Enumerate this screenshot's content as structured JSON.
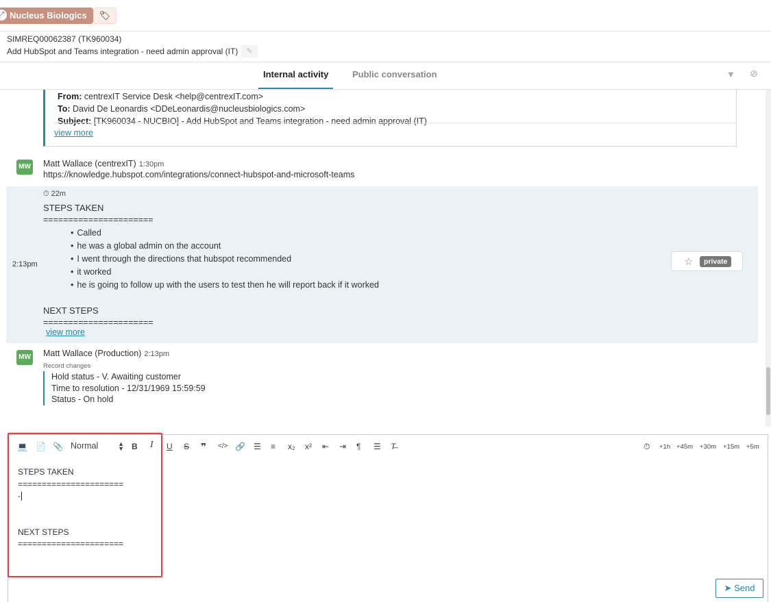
{
  "header": {
    "company": "Nucleus Biologics",
    "ext_icon": "external-link-icon",
    "tag_icon": "tags-icon"
  },
  "ticket": {
    "id": "SIMREQ00062387 (TK960034)",
    "title": "Add HubSpot and Teams integration - need admin approval (IT)"
  },
  "tabs": [
    {
      "label": "Internal activity",
      "active": true
    },
    {
      "label": "Public conversation",
      "active": false
    }
  ],
  "email_preview": {
    "from_label": "From:",
    "from": "centrexIT Service Desk <help@centrexIT.com>",
    "to_label": "To:",
    "to": "David De Leonardis <DDeLeonardis@nucleusbiologics.com>",
    "subject_label": "Subject:",
    "subject": "[TK960034 - NUCBIO] - Add HubSpot and Teams integration - need admin approval (IT)",
    "view_more": "view more"
  },
  "entries": [
    {
      "avatar": "MW",
      "author": "Matt Wallace (centrexIT)",
      "time": "1:30pm",
      "text": "https://knowledge.hubspot.com/integrations/connect-hubspot-and-microsoft-teams"
    }
  ],
  "note": {
    "time": "2:13pm",
    "duration": "22m",
    "heading1": "STEPS TAKEN",
    "sep1": "======================",
    "bullets": [
      "Called",
      "he was a global admin on the account",
      "I went through the directions that hubspot recommended",
      "it worked",
      "he is going to follow up with the users to test then he will report back if it worked"
    ],
    "heading2": "NEXT STEPS",
    "sep2": "======================",
    "view_more": "view more",
    "private_label": "private"
  },
  "record_entry": {
    "avatar": "MW",
    "author": "Matt Wallace (Production)",
    "time": "2:13pm",
    "label": "Record changes",
    "changes": [
      "Hold status - V. Awaiting customer",
      "Time to resolution - 12/31/1969 15:59:59",
      "Status - On hold"
    ]
  },
  "editor": {
    "format": "Normal",
    "time_buttons": [
      "+1h",
      "+45m",
      "+30m",
      "+15m",
      "+5m"
    ],
    "lines": [
      "STEPS TAKEN",
      "======================",
      "-",
      "",
      "",
      "NEXT STEPS",
      "======================"
    ],
    "send_label": "Send"
  },
  "colors": {
    "accent": "#2e86ab",
    "company_badge": "#c8907e",
    "avatar": "#5cab5c",
    "note_bg": "#eaf2f5",
    "highlight": "#d64444"
  }
}
